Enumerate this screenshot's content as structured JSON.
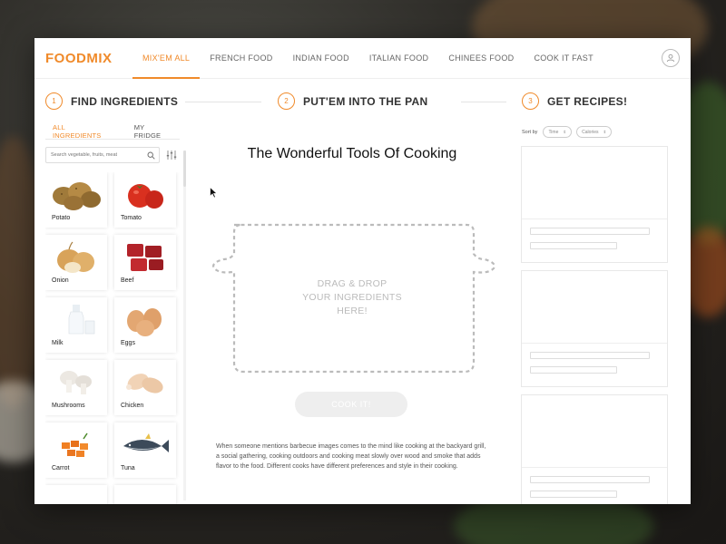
{
  "app": {
    "logo": "FOODMIX",
    "nav": [
      "MIX'EM ALL",
      "FRENCH FOOD",
      "INDIAN FOOD",
      "ITALIAN FOOD",
      "CHINEES FOOD",
      "COOK IT FAST"
    ],
    "active_nav": "MIX'EM ALL"
  },
  "steps": [
    {
      "num": "1",
      "label": "FIND INGREDIENTS"
    },
    {
      "num": "2",
      "label": "PUT'EM INTO THE PAN"
    },
    {
      "num": "3",
      "label": "GET RECIPES!"
    }
  ],
  "ingredients_panel": {
    "tabs": [
      "ALL INGREDIENTS",
      "MY FRIDGE"
    ],
    "active_tab": "ALL INGREDIENTS",
    "search_placeholder": "Search vegetable, fruits, meat",
    "items": [
      "Potato",
      "Tomato",
      "Onion",
      "Beef",
      "Milk",
      "Eggs",
      "Mushrooms",
      "Chicken",
      "Carrot",
      "Tuna"
    ]
  },
  "pan": {
    "title": "The Wonderful Tools Of Cooking",
    "drop_text": [
      "DRAG & DROP",
      "YOUR INGREDIENTS",
      "HERE!"
    ],
    "cook_button": "COOK IT!",
    "description": "When someone mentions barbecue images comes to the mind like cooking at the backyard grill, a social gathering, cooking outdoors and cooking meat slowly over wood and smoke that adds flavor to the food. Different cooks have different preferences and style in their cooking."
  },
  "recipes": {
    "sort_label": "Sort by",
    "sort_options": [
      "Time",
      "Calories"
    ]
  },
  "colors": {
    "accent": "#f08a2a"
  }
}
